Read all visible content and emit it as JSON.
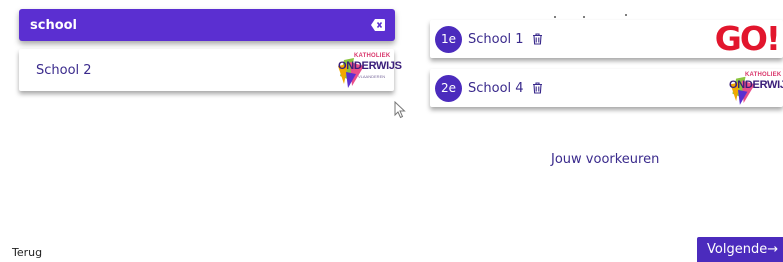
{
  "search": {
    "value": "school",
    "clear_icon": "clear-backspace-icon"
  },
  "results": [
    {
      "name": "School 2",
      "logo": {
        "top": "KATHOLIEK",
        "main": "ONDERWIJS",
        "sub": "VLAANDEREN"
      }
    }
  ],
  "preferences": [
    {
      "rank": "1e",
      "name": "School 1",
      "delete_icon": "trash-icon",
      "logo": {
        "text": "GO!"
      }
    },
    {
      "rank": "2e",
      "name": "School 4",
      "delete_icon": "trash-icon",
      "logo": {
        "top": "KATHOLIEK",
        "main": "ONDERWIJS"
      }
    }
  ],
  "preferences_title": "Jouw voorkeuren",
  "footer": {
    "back_label": "Terug",
    "next_label": "Volgende→"
  },
  "colors": {
    "accent": "#5b2fd1",
    "badge": "#4b2bbd",
    "text": "#3a2a8c",
    "go_red": "#e2162d"
  }
}
